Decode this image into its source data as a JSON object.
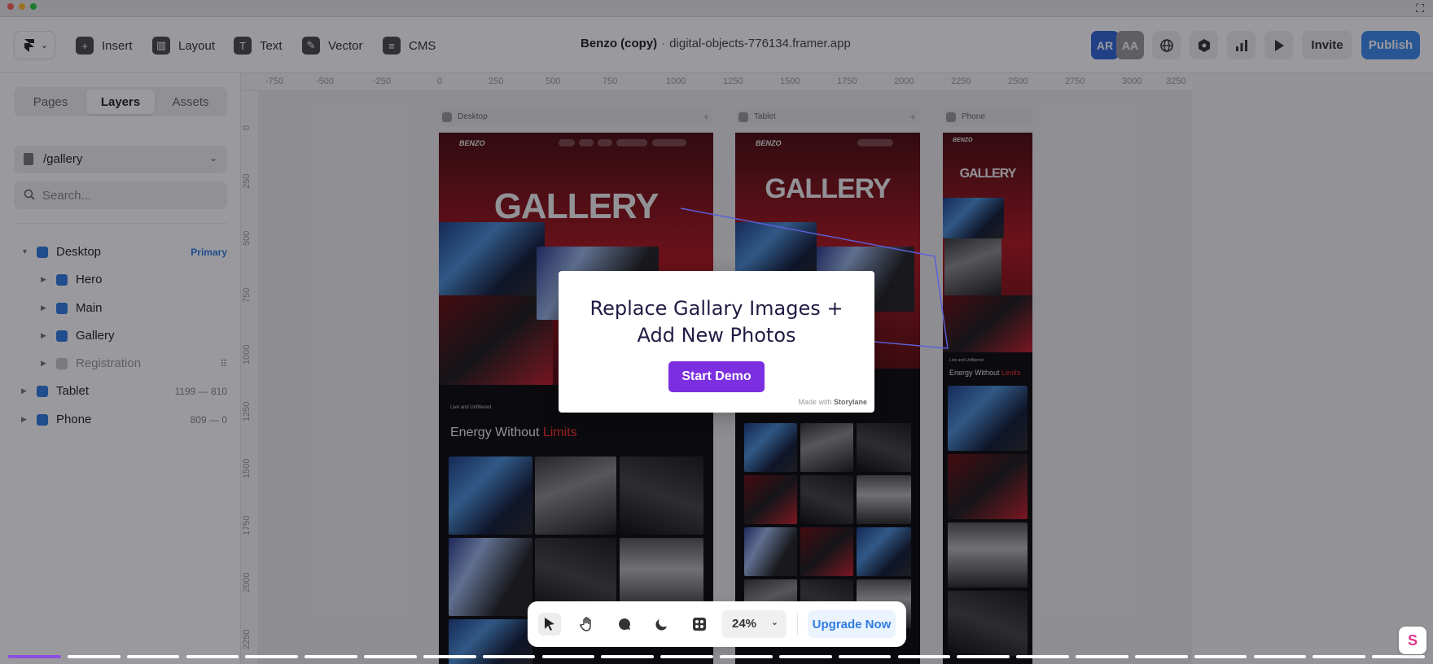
{
  "toolbar": {
    "insert": "Insert",
    "layout": "Layout",
    "text": "Text",
    "vector": "Vector",
    "cms": "CMS",
    "project_name": "Benzo (copy)",
    "separator": "·",
    "project_url": "digital-objects-776134.framer.app",
    "avatar_1": "AR",
    "avatar_2": "AA",
    "invite": "Invite",
    "publish": "Publish"
  },
  "sidebar": {
    "tabs": [
      "Pages",
      "Layers",
      "Assets"
    ],
    "active_tab": "Layers",
    "current_page": "/gallery",
    "search_placeholder": "Search...",
    "layers": [
      {
        "name": "Desktop",
        "meta": "Primary",
        "expanded": true
      },
      {
        "name": "Hero",
        "meta": ""
      },
      {
        "name": "Main",
        "meta": ""
      },
      {
        "name": "Gallery",
        "meta": ""
      },
      {
        "name": "Registration",
        "meta": "⠿"
      },
      {
        "name": "Tablet",
        "meta": "1199 — 810"
      },
      {
        "name": "Phone",
        "meta": "809 — 0"
      }
    ]
  },
  "canvas": {
    "ruler_top": [
      "-750",
      "-500",
      "-250",
      "0",
      "250",
      "500",
      "750",
      "1000",
      "1250",
      "1500",
      "1750",
      "2000",
      "2250",
      "2500",
      "2750",
      "3000",
      "3250"
    ],
    "ruler_left": [
      "0",
      "250",
      "500",
      "750",
      "1000",
      "1250",
      "1500",
      "1750",
      "2000",
      "2250"
    ],
    "frames": {
      "desktop_label": "Desktop",
      "tablet_label": "Tablet",
      "phone_label": "Phone",
      "gallery_title": "GALLERY",
      "logo_text": "BENZO",
      "tagline": "Live and Unfiltered",
      "energy_text": "Energy Without ",
      "energy_highlight": "Limits"
    }
  },
  "modal": {
    "heading_line1": "Replace Gallary Images +",
    "heading_line2": "Add New Photos",
    "button": "Start Demo",
    "made_with": "Made with",
    "brand": "Storylane"
  },
  "bottom_bar": {
    "zoom": "24%",
    "upgrade": "Upgrade Now"
  },
  "progress": {
    "segments_total": 24,
    "segments_done": 1
  },
  "colors": {
    "accent_blue": "#3b8aee",
    "demo_purple": "#7b2fe0",
    "progress_purple": "#8b4fe0",
    "gallery_red": "#b0141c"
  }
}
